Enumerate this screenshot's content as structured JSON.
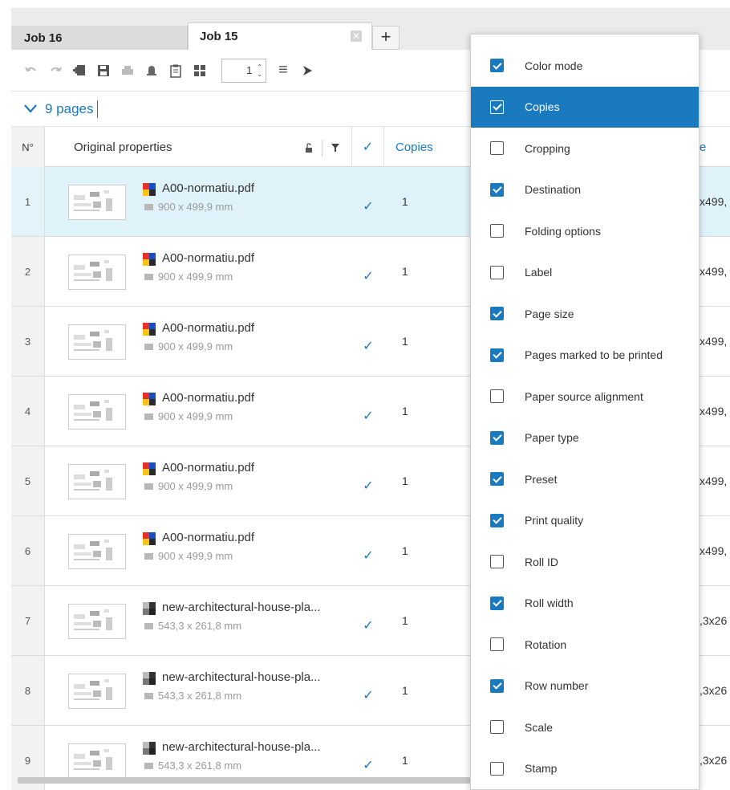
{
  "tabs": [
    {
      "label": "Job 16",
      "active": false
    },
    {
      "label": "Job 15",
      "active": true
    }
  ],
  "tab_close_icon": "close-icon",
  "add_tab_label": "+",
  "toolbar": {
    "page_stepper_value": "1",
    "icons": [
      "undo-icon",
      "redo-icon",
      "add-file-icon",
      "save-icon",
      "print-icon",
      "bell-icon",
      "clipboard-icon",
      "grid-icon",
      "menu-icon",
      "send-icon"
    ]
  },
  "pages_label": "9 pages",
  "table": {
    "headers": {
      "num": "N°",
      "original": "Original properties",
      "copies": "Copies",
      "partial": "e"
    },
    "rows": [
      {
        "num": "1",
        "file": "A00-normatiu.pdf",
        "size": "900 x 499,9 mm",
        "copies": "1",
        "partial": "x499,",
        "selected": true,
        "color": true
      },
      {
        "num": "2",
        "file": "A00-normatiu.pdf",
        "size": "900 x 499,9 mm",
        "copies": "1",
        "partial": "x499,",
        "selected": false,
        "color": true
      },
      {
        "num": "3",
        "file": "A00-normatiu.pdf",
        "size": "900 x 499,9 mm",
        "copies": "1",
        "partial": "x499,",
        "selected": false,
        "color": true
      },
      {
        "num": "4",
        "file": "A00-normatiu.pdf",
        "size": "900 x 499,9 mm",
        "copies": "1",
        "partial": "x499,",
        "selected": false,
        "color": true
      },
      {
        "num": "5",
        "file": "A00-normatiu.pdf",
        "size": "900 x 499,9 mm",
        "copies": "1",
        "partial": "x499,",
        "selected": false,
        "color": true
      },
      {
        "num": "6",
        "file": "A00-normatiu.pdf",
        "size": "900 x 499,9 mm",
        "copies": "1",
        "partial": "x499,",
        "selected": false,
        "color": true
      },
      {
        "num": "7",
        "file": "new-architectural-house-pla...",
        "size": "543,3 x 261,8 mm",
        "copies": "1",
        "partial": ",3x26",
        "selected": false,
        "color": false
      },
      {
        "num": "8",
        "file": "new-architectural-house-pla...",
        "size": "543,3 x 261,8 mm",
        "copies": "1",
        "partial": ",3x26",
        "selected": false,
        "color": false
      },
      {
        "num": "9",
        "file": "new-architectural-house-pla...",
        "size": "543,3 x 261,8 mm",
        "copies": "1",
        "partial": ",3x26",
        "selected": false,
        "color": false
      }
    ]
  },
  "column_menu": [
    {
      "label": "Color mode",
      "checked": true,
      "highlighted": false
    },
    {
      "label": "Copies",
      "checked": true,
      "highlighted": true
    },
    {
      "label": "Cropping",
      "checked": false,
      "highlighted": false
    },
    {
      "label": "Destination",
      "checked": true,
      "highlighted": false
    },
    {
      "label": "Folding options",
      "checked": false,
      "highlighted": false
    },
    {
      "label": "Label",
      "checked": false,
      "highlighted": false
    },
    {
      "label": "Page size",
      "checked": true,
      "highlighted": false
    },
    {
      "label": "Pages marked to be printed",
      "checked": true,
      "highlighted": false
    },
    {
      "label": "Paper source alignment",
      "checked": false,
      "highlighted": false
    },
    {
      "label": "Paper type",
      "checked": true,
      "highlighted": false
    },
    {
      "label": "Preset",
      "checked": true,
      "highlighted": false
    },
    {
      "label": "Print quality",
      "checked": true,
      "highlighted": false
    },
    {
      "label": "Roll ID",
      "checked": false,
      "highlighted": false
    },
    {
      "label": "Roll width",
      "checked": true,
      "highlighted": false
    },
    {
      "label": "Rotation",
      "checked": false,
      "highlighted": false
    },
    {
      "label": "Row number",
      "checked": true,
      "highlighted": false
    },
    {
      "label": "Scale",
      "checked": false,
      "highlighted": false
    },
    {
      "label": "Stamp",
      "checked": false,
      "highlighted": false
    }
  ],
  "colors": {
    "accent": "#1a7ac0",
    "selected_row": "#dff2fa",
    "tab_bar": "#ebebeb"
  }
}
